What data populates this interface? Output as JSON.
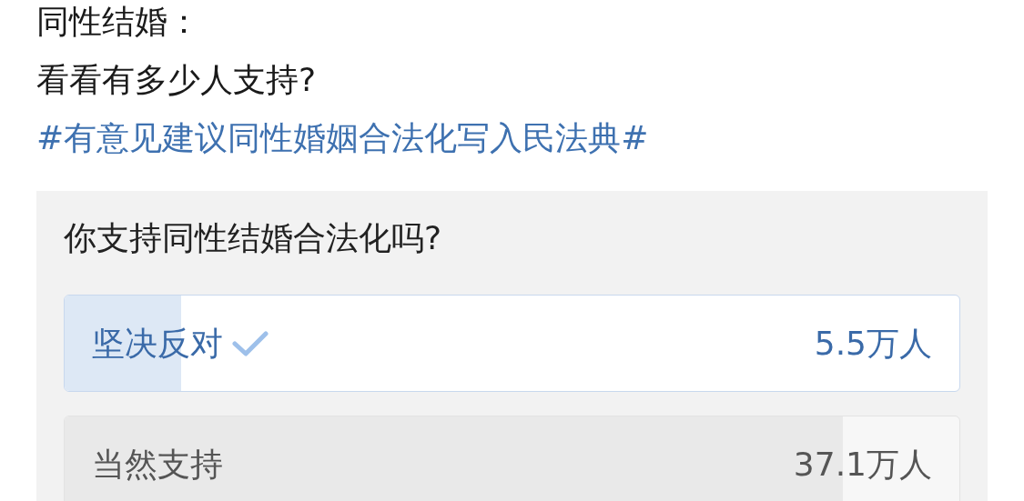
{
  "post": {
    "lines": [
      "同性结婚：",
      "看看有多少人支持?"
    ],
    "hashtag": "#有意见建议同性婚姻合法化写入民法典#"
  },
  "poll": {
    "question": "你支持同性结婚合法化吗?",
    "options": [
      {
        "label": "坚决反对",
        "count": "5.5万人",
        "selected": true,
        "level": 0.13
      },
      {
        "label": "当然支持",
        "count": "37.1万人",
        "selected": false,
        "level": 0.87
      }
    ]
  }
}
